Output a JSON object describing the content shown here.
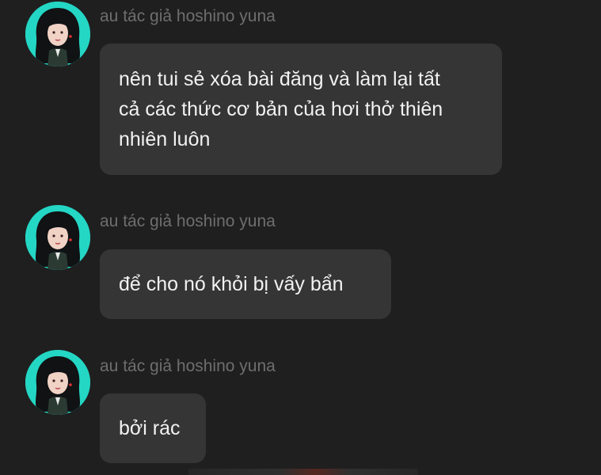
{
  "messages": [
    {
      "sender": "au tác giả hoshino yuna",
      "text": "nên tui sẻ xóa bài đăng và làm lại tất\ncả các thức cơ bản của hơi thở thiên\nnhiên luôn"
    },
    {
      "sender": "au tác giả hoshino yuna",
      "text": "để cho nó khỏi bị vấy bẩn"
    },
    {
      "sender": "au tác giả hoshino yuna",
      "text": "bởi rác"
    }
  ],
  "colors": {
    "background": "#1f1f1f",
    "bubble": "#353535",
    "sender_text": "#6e6e6e",
    "message_text": "#f2f2f2",
    "avatar_bg": "#24d6c4"
  },
  "icons": {
    "avatar": "anime-girl-avatar"
  }
}
